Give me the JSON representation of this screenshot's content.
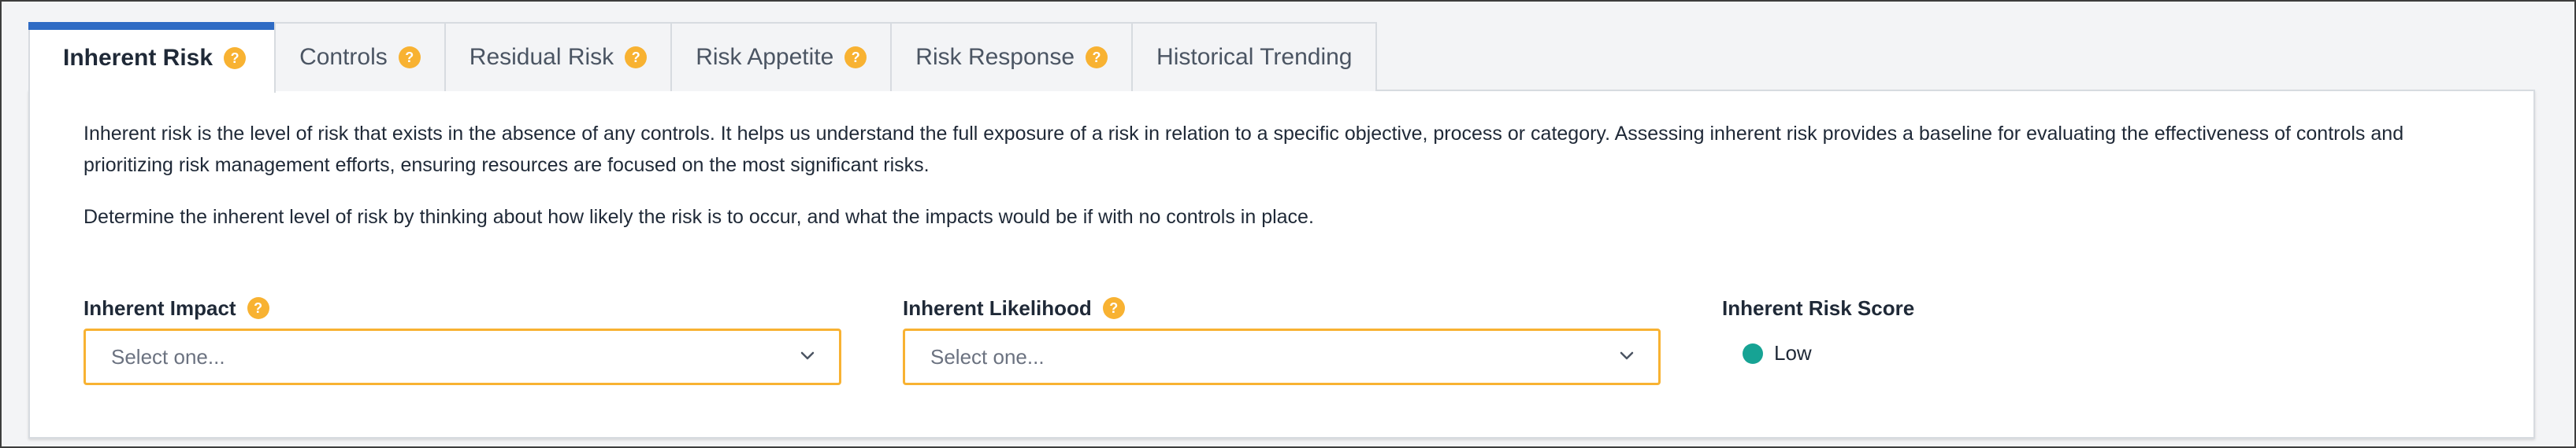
{
  "tabs": [
    {
      "label": "Inherent Risk",
      "has_help": true,
      "active": true
    },
    {
      "label": "Controls",
      "has_help": true,
      "active": false
    },
    {
      "label": "Residual Risk",
      "has_help": true,
      "active": false
    },
    {
      "label": "Risk Appetite",
      "has_help": true,
      "active": false
    },
    {
      "label": "Risk Response",
      "has_help": true,
      "active": false
    },
    {
      "label": "Historical Trending",
      "has_help": false,
      "active": false
    }
  ],
  "help_icon_text": "?",
  "description": {
    "paragraph_1": "Inherent risk is the level of risk that exists in the absence of any controls. It helps us understand the full exposure of a risk in relation to a specific objective, process or category. Assessing inherent risk provides a baseline for evaluating the effectiveness of controls and prioritizing risk management efforts, ensuring resources are focused on the most significant risks.",
    "paragraph_2": "Determine the inherent level of risk by thinking about how likely the risk is to occur, and what the impacts would be if with no controls in place."
  },
  "fields": {
    "impact": {
      "label": "Inherent Impact",
      "selected": "Select one..."
    },
    "likelihood": {
      "label": "Inherent Likelihood",
      "selected": "Select one..."
    },
    "score": {
      "label": "Inherent Risk Score",
      "value": "Low"
    }
  },
  "colors": {
    "active_tab_indicator": "#2f6bc4",
    "help_icon": "#f8b232",
    "select_border": "#f8b232",
    "status_low": "#16a394"
  }
}
